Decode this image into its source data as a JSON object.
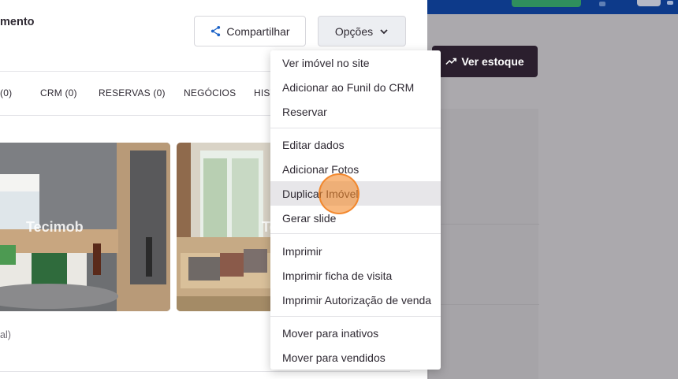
{
  "header": {
    "title_fragment": "mento",
    "share_label": "Compartilhar",
    "options_label": "Opções",
    "stock_label": "Ver estoque"
  },
  "tabs": [
    {
      "label": "(0)"
    },
    {
      "label": "CRM (0)"
    },
    {
      "label": "RESERVAS (0)"
    },
    {
      "label": "NEGÓCIOS"
    },
    {
      "label": "HIST"
    }
  ],
  "photos": {
    "watermark_1": "Tecimob",
    "watermark_2": "Te"
  },
  "caption_fragment": "al)",
  "menu": {
    "groups": [
      [
        "Ver imóvel no site",
        "Adicionar ao Funil do CRM",
        "Reservar"
      ],
      [
        "Editar dados",
        "Adicionar Fotos",
        "Duplicar Imóvel",
        "Gerar slide"
      ],
      [
        "Imprimir",
        "Imprimir ficha de visita",
        "Imprimir Autorização de venda"
      ],
      [
        "Mover para inativos",
        "Mover para vendidos"
      ]
    ],
    "highlighted_item": "Duplicar Imóvel"
  },
  "colors": {
    "topbar": "#0d3a8a",
    "topbar_button": "#2f8f5d",
    "dark_button": "#2b1f2e",
    "cursor_highlight": "#f48a2c"
  },
  "icons": {
    "share": "share-icon",
    "options_chevron": "chevron-down-icon",
    "stock": "trending-up-icon"
  }
}
